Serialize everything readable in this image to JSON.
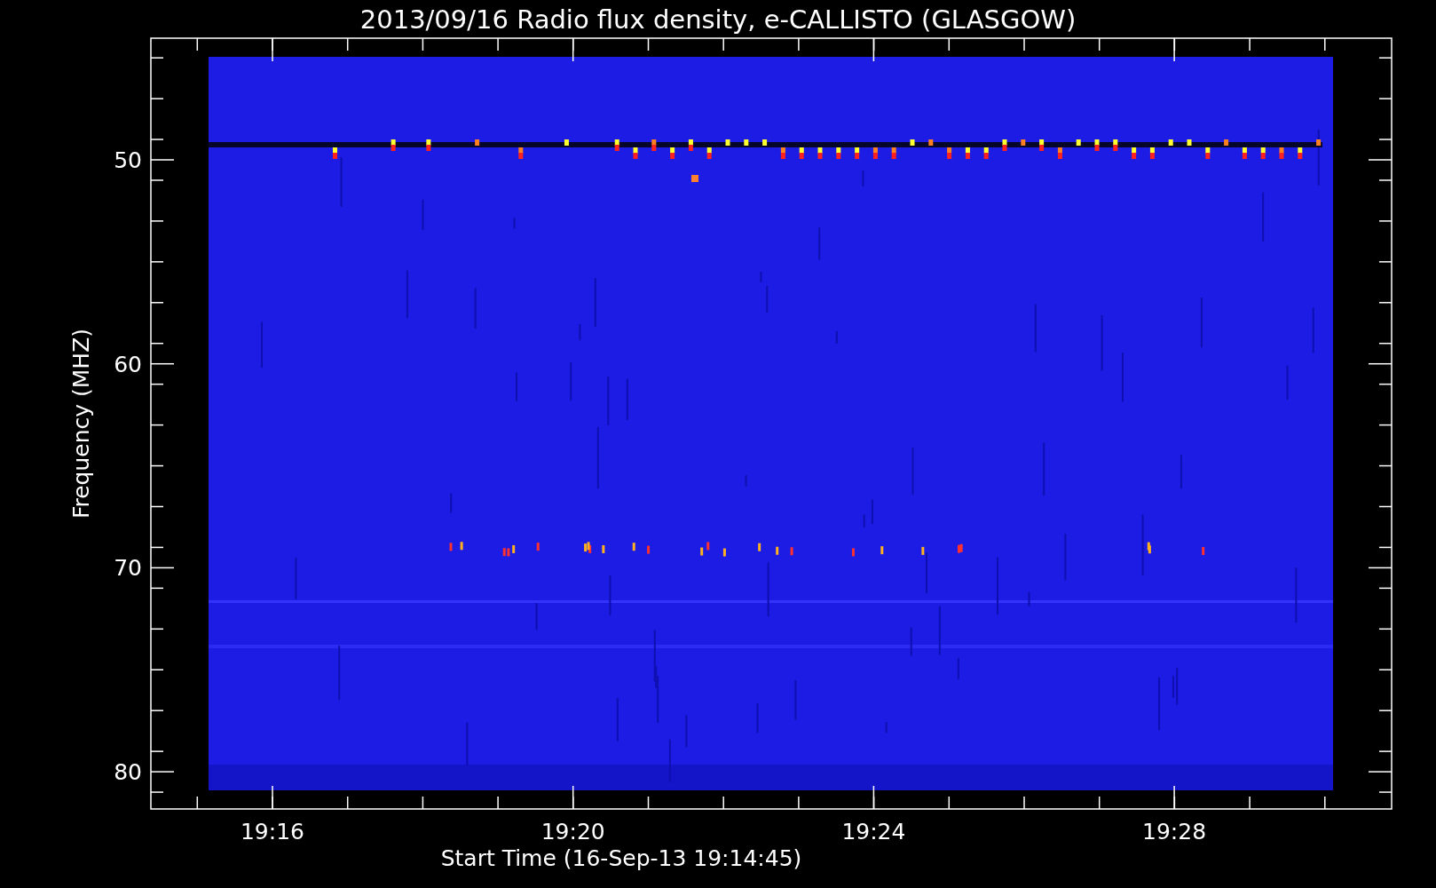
{
  "title": "2013/09/16  Radio flux density, e-CALLISTO (GLASGOW)",
  "y_axis": {
    "label": "Frequency (MHZ)",
    "ticks": [
      "50",
      "60",
      "70",
      "80"
    ]
  },
  "x_axis": {
    "label": "Start Time (16-Sep-13 19:14:45)",
    "ticks": [
      "19:16",
      "19:20",
      "19:24",
      "19:28"
    ]
  }
}
